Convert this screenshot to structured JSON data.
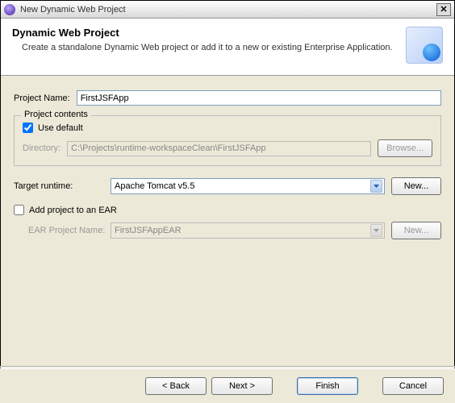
{
  "window": {
    "title": "New Dynamic Web Project"
  },
  "banner": {
    "title": "Dynamic Web Project",
    "description": "Create a standalone Dynamic Web project or add it to a new or existing Enterprise Application."
  },
  "projectName": {
    "label": "Project Name:",
    "value": "FirstJSFApp"
  },
  "contents": {
    "legend": "Project contents",
    "useDefault": {
      "label": "Use default",
      "checked": true
    },
    "directory": {
      "label": "Directory:",
      "value": "C:\\Projects\\runtime-workspaceClean\\FirstJSFApp",
      "browse": "Browse..."
    }
  },
  "runtime": {
    "label": "Target runtime:",
    "value": "Apache Tomcat v5.5",
    "newBtn": "New..."
  },
  "ear": {
    "addLabel": "Add project to an EAR",
    "checked": false,
    "projectLabel": "EAR Project Name:",
    "projectValue": "FirstJSFAppEAR",
    "newBtn": "New..."
  },
  "footer": {
    "back": "< Back",
    "next": "Next >",
    "finish": "Finish",
    "cancel": "Cancel"
  }
}
